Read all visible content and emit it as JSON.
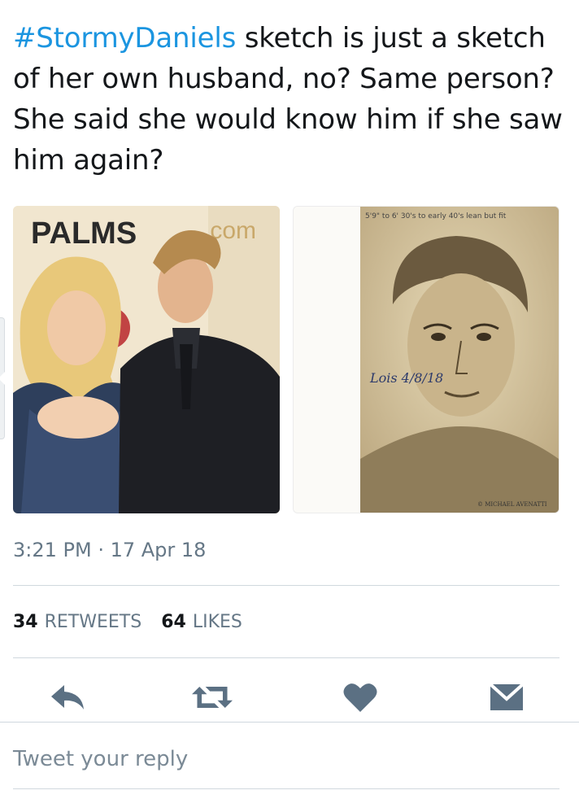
{
  "tweet": {
    "hashtag": "#StormyDaniels",
    "body": " sketch is just a sketch of her own husband, no? Same person? She said she would know him if she saw him again?",
    "timestamp": "3:21 PM · 17 Apr 18",
    "retweets_count": "34",
    "retweets_label": "RETWEETS",
    "likes_count": "64",
    "likes_label": "LIKES"
  },
  "media": {
    "left_photo_banner": "PALMS",
    "left_photo_banner_2": ".com",
    "right_sketch_notes": "5'9\" to 6'  30's to early 40's  lean but fit",
    "right_sketch_signature": "Lois 4/8/18",
    "right_sketch_credit": "© MICHAEL AVENATTI"
  },
  "actions": {
    "reply_icon": "reply-icon",
    "retweet_icon": "retweet-icon",
    "like_icon": "heart-icon",
    "dm_icon": "envelope-icon"
  },
  "reply": {
    "placeholder": "Tweet your reply"
  },
  "colors": {
    "accent": "#1b95e0",
    "icon": "#5b7083",
    "muted": "#657786"
  }
}
